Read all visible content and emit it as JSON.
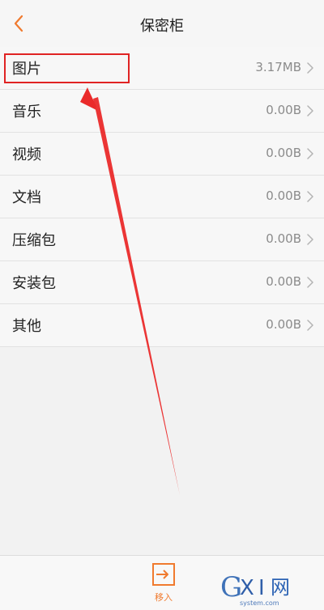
{
  "header": {
    "title": "保密柜",
    "back_icon": "chevron-left-icon"
  },
  "rows": [
    {
      "label": "图片",
      "value": "3.17MB"
    },
    {
      "label": "音乐",
      "value": "0.00B"
    },
    {
      "label": "视频",
      "value": "0.00B"
    },
    {
      "label": "文档",
      "value": "0.00B"
    },
    {
      "label": "压缩包",
      "value": "0.00B"
    },
    {
      "label": "安装包",
      "value": "0.00B"
    },
    {
      "label": "其他",
      "value": "0.00B"
    }
  ],
  "bottom_bar": {
    "move_in_label": "移入",
    "move_in_icon": "enter-icon"
  },
  "watermark": {
    "logo_text": "GXI网",
    "site_text": "system.com"
  },
  "colors": {
    "accent": "#f07a2e",
    "annotation_red": "#e02323"
  }
}
